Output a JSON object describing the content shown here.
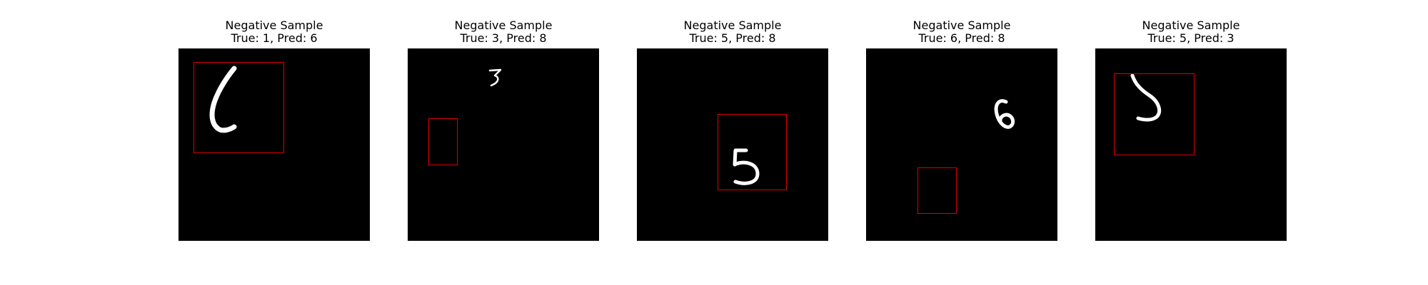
{
  "panels": [
    {
      "title": "Negative Sample",
      "subtitle": "True: 1, Pred: 6",
      "digit_icon": "handwritten-digit-1"
    },
    {
      "title": "Negative Sample",
      "subtitle": "True: 3, Pred: 8",
      "digit_icon": "handwritten-digit-3"
    },
    {
      "title": "Negative Sample",
      "subtitle": "True: 5, Pred: 8",
      "digit_icon": "handwritten-digit-5"
    },
    {
      "title": "Negative Sample",
      "subtitle": "True: 6, Pred: 8",
      "digit_icon": "handwritten-digit-6"
    },
    {
      "title": "Negative Sample",
      "subtitle": "True: 5, Pred: 3",
      "digit_icon": "handwritten-digit-5"
    }
  ],
  "colors": {
    "image_background": "#000000",
    "digit_stroke": "#ffffff",
    "bounding_box": "#e00000"
  }
}
